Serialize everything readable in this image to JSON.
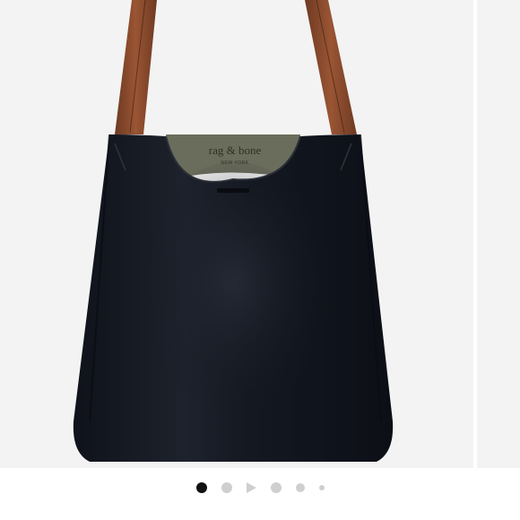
{
  "brand_label": {
    "line1": "rag & bone",
    "line2": "NEW YORK"
  },
  "carousel": {
    "count": 6,
    "active_index": 0,
    "video_index": 2
  },
  "colors": {
    "bag_leather": "#141821",
    "strap_brown": "#8a4a2c",
    "lining_olive": "#6b6d5c",
    "dot_active": "#111111",
    "dot_inactive": "#cfcfcf"
  }
}
